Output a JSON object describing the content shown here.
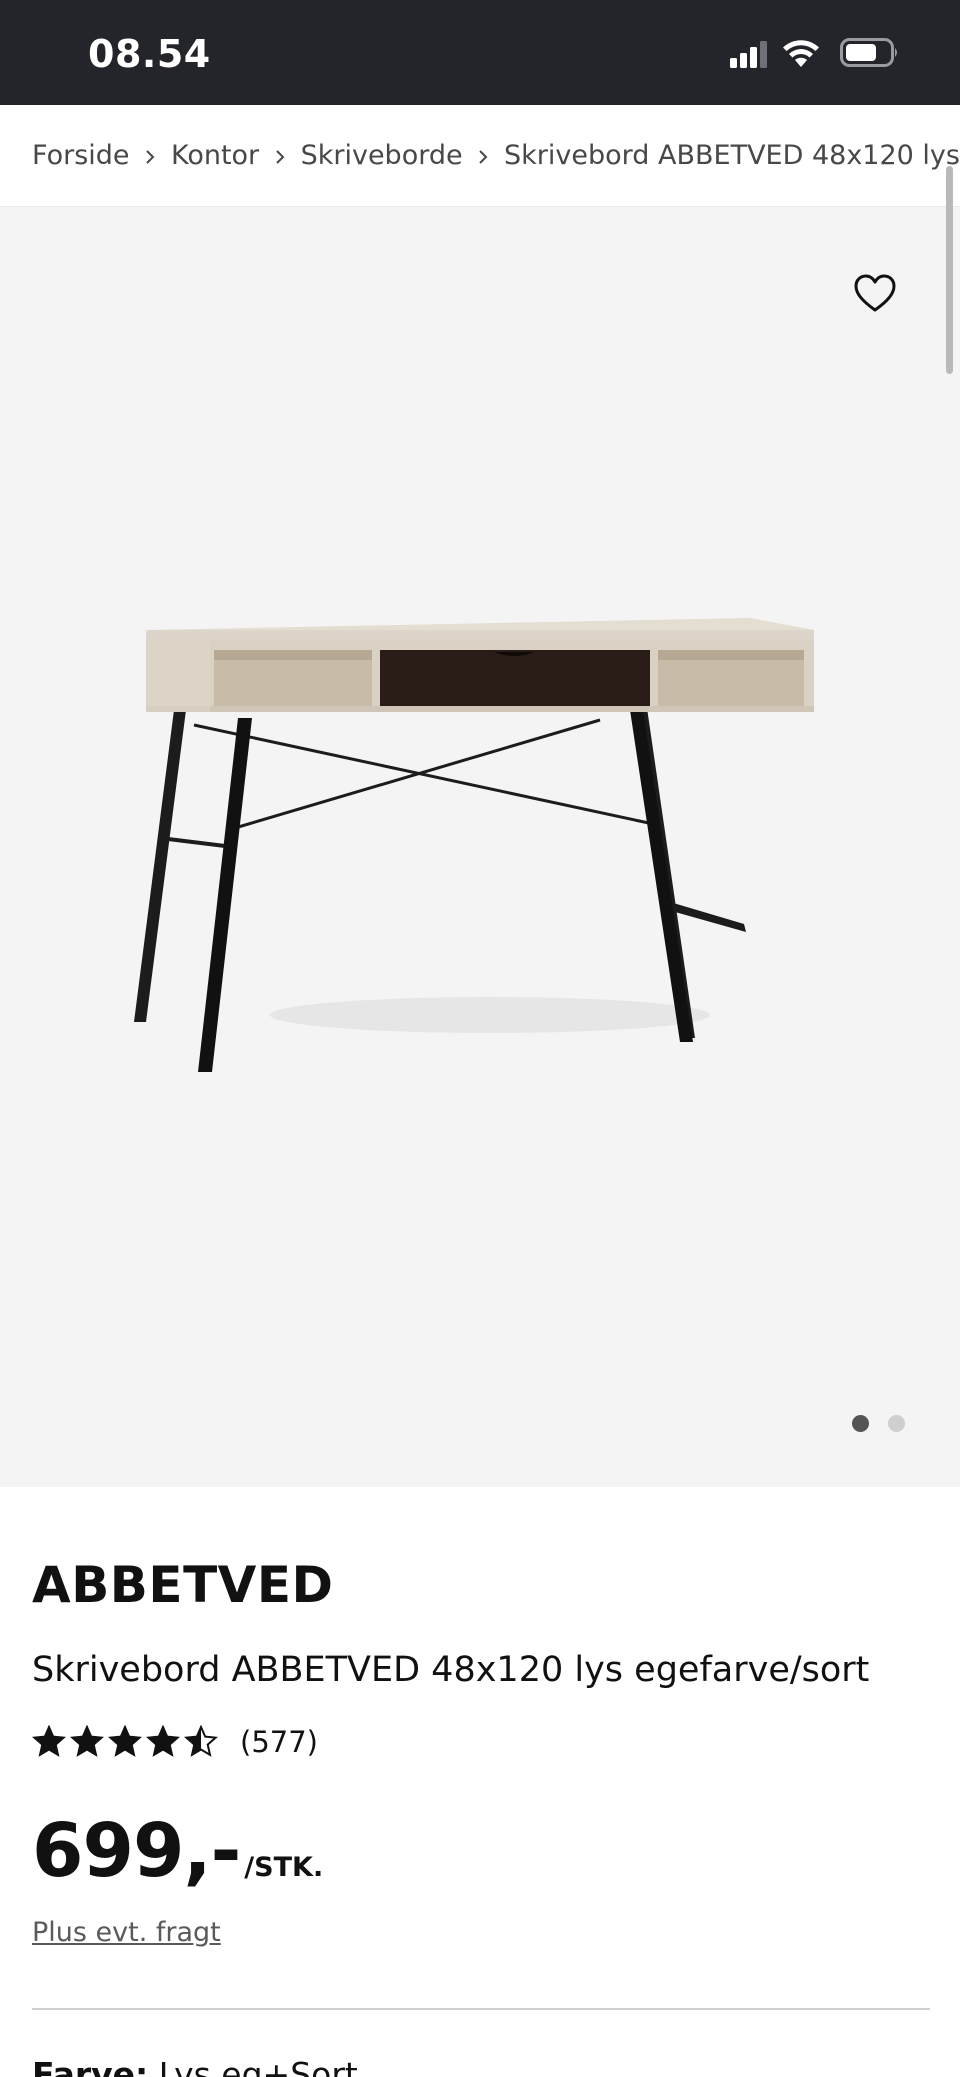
{
  "status_bar": {
    "time": "08.54"
  },
  "breadcrumb": {
    "items": [
      "Forside",
      "Kontor",
      "Skriveborde",
      "Skrivebord ABBETVED 48x120 lys"
    ]
  },
  "gallery": {
    "image_alt": "Skrivebord ABBETVED 48x120 lys egefarve/sort",
    "image_count": 2,
    "active_index": 1,
    "dot_active_color": "#555555",
    "dot_inactive_color": "#cfcfcf"
  },
  "product": {
    "brand": "ABBETVED",
    "name": "Skrivebord ABBETVED 48x120 lys egefarve/sort",
    "rating": 4.5,
    "rating_max": 5,
    "review_count": "(577)",
    "price": "699,-",
    "price_unit": "/STK.",
    "shipping": "Plus evt. fragt",
    "color_label": "Farve:",
    "color_value": " Lys eg+Sort"
  },
  "icons": {
    "favorite": "heart-outline-icon",
    "separator": "chevron-right-icon",
    "signal": "cellular-signal-icon",
    "wifi": "wifi-icon",
    "battery": "battery-icon"
  }
}
